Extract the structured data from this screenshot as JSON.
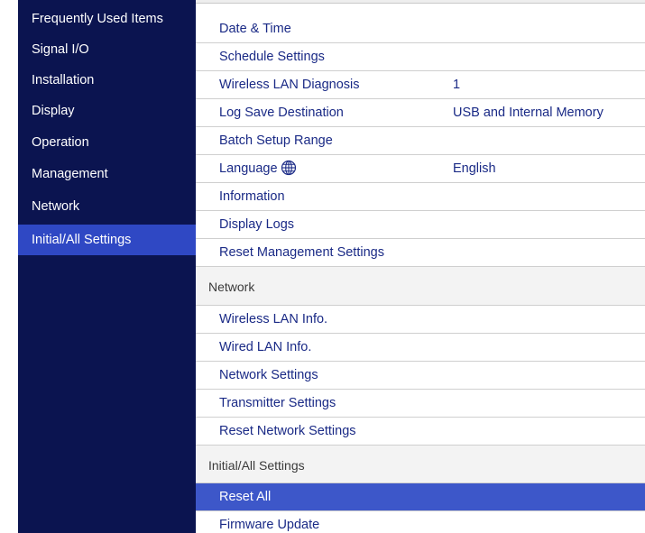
{
  "sidebar": {
    "items": [
      {
        "label": "Frequently Used Items"
      },
      {
        "label": "Signal I/O"
      },
      {
        "label": "Installation"
      },
      {
        "label": "Display"
      },
      {
        "label": "Operation"
      },
      {
        "label": "Management"
      },
      {
        "label": "Network"
      },
      {
        "label": "Initial/All Settings",
        "selected": true
      }
    ]
  },
  "management": {
    "items": [
      {
        "label": "Date & Time"
      },
      {
        "label": "Schedule Settings"
      },
      {
        "label": "Wireless LAN Diagnosis",
        "value": "1"
      },
      {
        "label": "Log Save Destination",
        "value": "USB and Internal Memory"
      },
      {
        "label": "Batch Setup Range"
      },
      {
        "label": "Language",
        "icon": "globe-icon",
        "value": "English"
      },
      {
        "label": "Information"
      },
      {
        "label": "Display Logs"
      },
      {
        "label": "Reset Management Settings"
      }
    ]
  },
  "network": {
    "header": "Network",
    "items": [
      {
        "label": "Wireless LAN Info."
      },
      {
        "label": "Wired LAN Info."
      },
      {
        "label": "Network Settings"
      },
      {
        "label": "Transmitter Settings"
      },
      {
        "label": "Reset Network Settings"
      }
    ]
  },
  "initial_all": {
    "header": "Initial/All Settings",
    "items": [
      {
        "label": "Reset All",
        "selected": true
      },
      {
        "label": "Firmware Update"
      }
    ]
  },
  "colors": {
    "sidebar_bg": "#0b1450",
    "sidebar_selected": "#2f48c4",
    "row_text": "#1a2a86",
    "row_selected": "#3d57c9",
    "section_bg": "#f3f3f3"
  }
}
